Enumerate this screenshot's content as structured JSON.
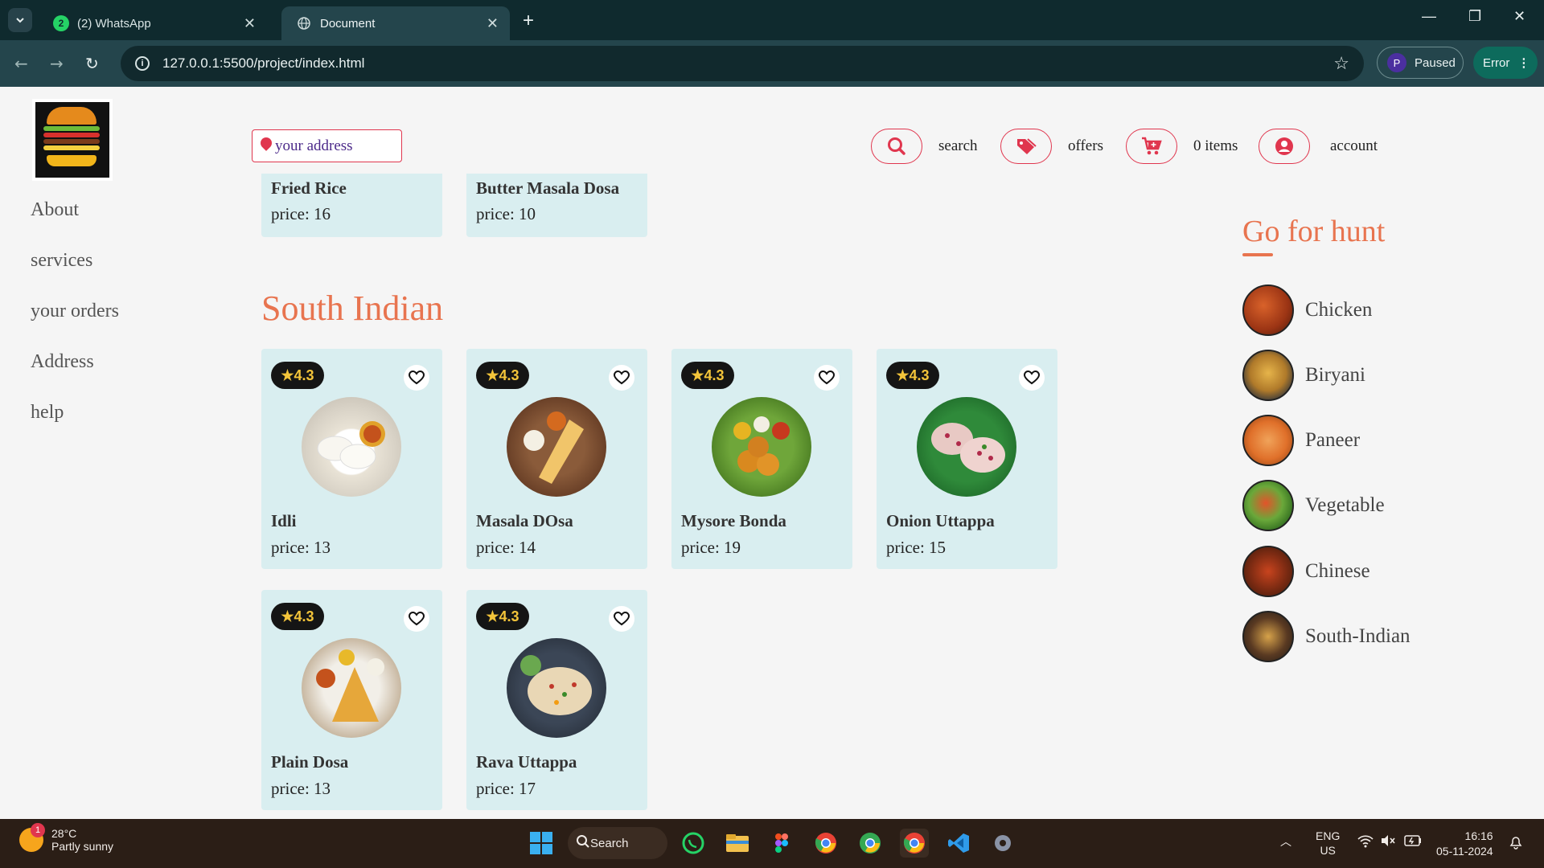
{
  "browser": {
    "tabs": [
      {
        "title": "(2) WhatsApp",
        "badge": "2"
      },
      {
        "title": "Document"
      }
    ],
    "url": "127.0.0.1:5500/project/index.html",
    "profile_initial": "P",
    "profile_label": "Paused",
    "error_label": "Error"
  },
  "page": {
    "address_placeholder": "your address",
    "sidebar": [
      "About",
      "services",
      "your orders",
      "Address",
      "help"
    ],
    "topnav": {
      "search": "search",
      "offers": "offers",
      "cart": "0 items",
      "account": "account"
    },
    "partial_cards": [
      {
        "name": "Fried Rice",
        "price": "price: 16"
      },
      {
        "name": "Butter Masala Dosa",
        "price": "price: 10"
      }
    ],
    "section_title": "South Indian",
    "cards": [
      {
        "name": "Idli",
        "price": "price: 13",
        "rating": "4.3"
      },
      {
        "name": "Masala DOsa",
        "price": "price: 14",
        "rating": "4.3"
      },
      {
        "name": "Mysore Bonda",
        "price": "price: 19",
        "rating": "4.3"
      },
      {
        "name": "Onion Uttappa",
        "price": "price: 15",
        "rating": "4.3"
      },
      {
        "name": "Plain Dosa",
        "price": "price: 13",
        "rating": "4.3"
      },
      {
        "name": "Rava Uttappa",
        "price": "price: 17",
        "rating": "4.3"
      }
    ],
    "hunt": {
      "title": "Go for hunt",
      "items": [
        "Chicken",
        "Biryani",
        "Paneer",
        "Vegetable",
        "Chinese",
        "South-Indian"
      ]
    }
  },
  "taskbar": {
    "temperature": "28°C",
    "weather": "Partly sunny",
    "weather_badge": "1",
    "search_label": "Search",
    "lang": "ENG",
    "region": "US",
    "time": "16:16",
    "date": "05-11-2024"
  },
  "colors": {
    "accent": "#e8744f",
    "border_red": "#e0364e",
    "card_bg": "#d9eef0",
    "rating_star": "#f3c43a"
  }
}
